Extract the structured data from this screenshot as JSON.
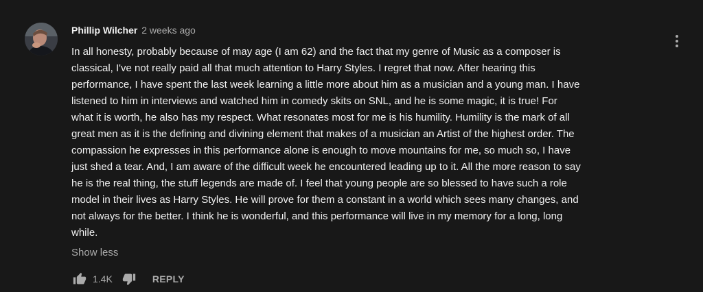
{
  "comment": {
    "author": "Phillip Wilcher",
    "timestamp": "2 weeks ago",
    "text_lines": [
      "In all honesty, probably because of may age (I am 62) and the fact that my genre of Music as a composer is",
      "classical, I've not really paid all that much attention to Harry Styles. I regret that now. After hearing this",
      "performance, I have spent the last week learning a little more about him as a musician and a young man. I have",
      "listened to him in interviews and watched him in comedy skits on SNL, and he is some magic, it is true!  For",
      "what it is worth, he also has my respect. What resonates most for me is his humility. Humility is the mark of all",
      "great men as it is the defining and divining element that makes of a musician an Artist of the highest order. The",
      "compassion he expresses in this performance alone is enough to move mountains for me, so much so, I have",
      "just shed a tear. And, I am aware of the difficult week he encountered leading up to it. All the more reason to say",
      "he is the real thing, the stuff legends are made of. I feel that young people are so blessed to have such a role",
      "model in their lives as Harry Styles. He will prove for them a constant in a world which sees many changes, and",
      "not always for the better. I think he is wonderful, and this performance will live in my memory for a long, long",
      "while."
    ],
    "show_less_label": "Show less",
    "like_count": "1.4K",
    "reply_label": "REPLY"
  },
  "icons": {
    "like": "thumbs-up-icon",
    "dislike": "thumbs-down-icon",
    "menu": "more-vertical-icon"
  },
  "colors": {
    "background": "#181818",
    "primary_text": "#f1f1f1",
    "secondary_text": "#aaaaaa"
  }
}
